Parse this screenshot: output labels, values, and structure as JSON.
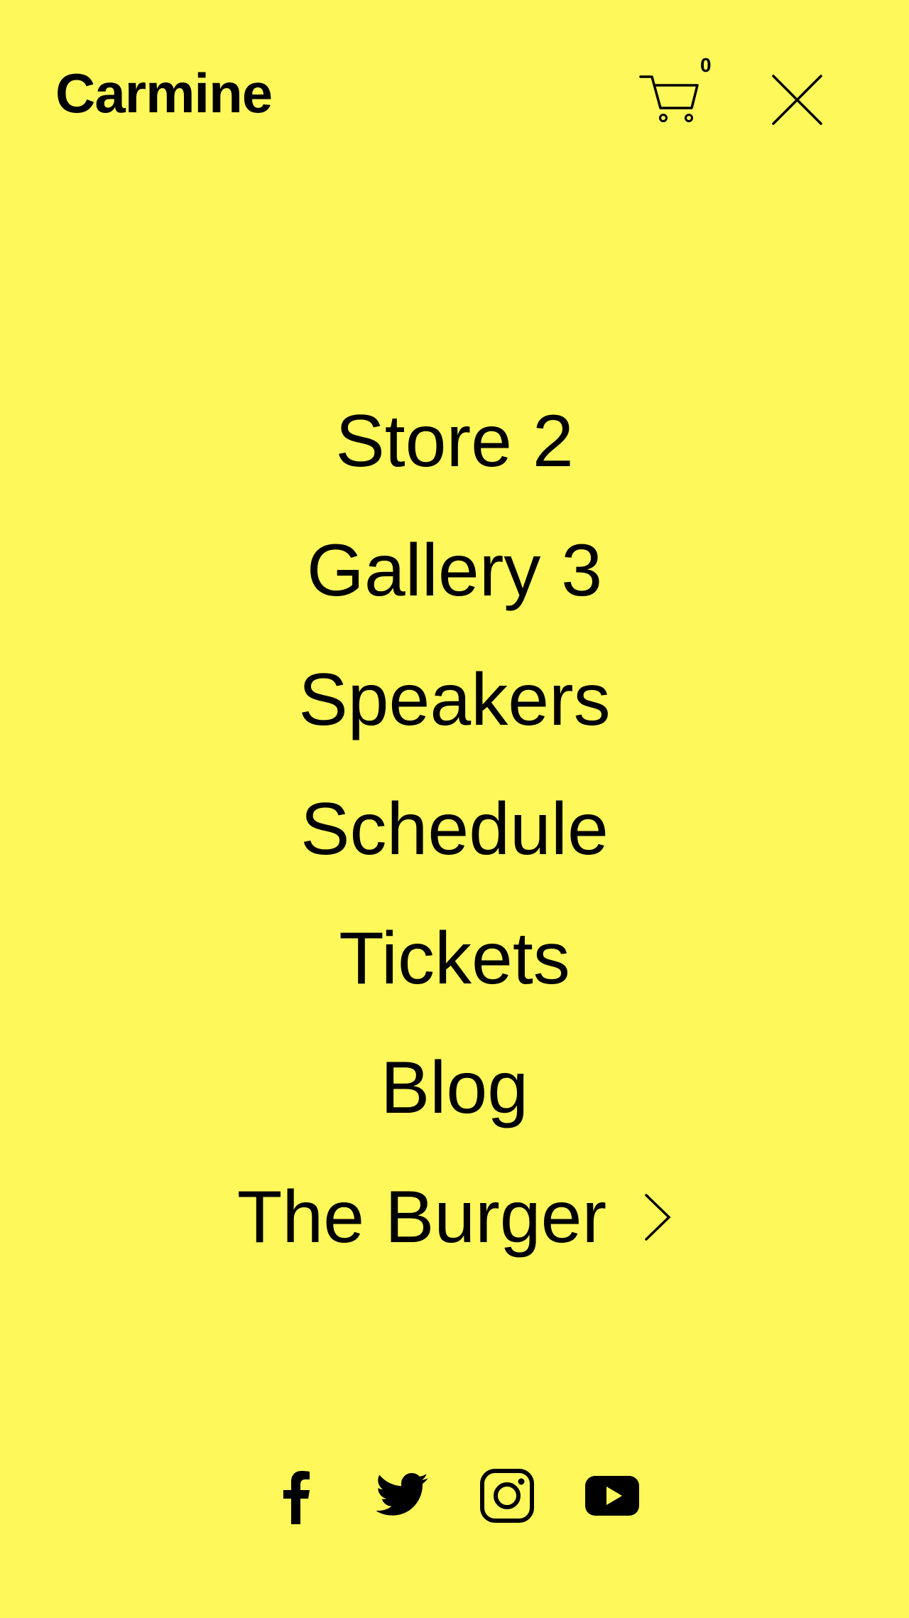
{
  "header": {
    "logo": "Carmine",
    "cart_count": "0"
  },
  "nav": {
    "items": [
      {
        "label": "Store 2"
      },
      {
        "label": "Gallery 3"
      },
      {
        "label": "Speakers"
      },
      {
        "label": "Schedule"
      },
      {
        "label": "Tickets"
      },
      {
        "label": "Blog"
      },
      {
        "label": "The Burger",
        "has_submenu": true
      }
    ]
  },
  "social": {
    "icons": [
      "facebook-icon",
      "twitter-icon",
      "instagram-icon",
      "youtube-icon"
    ]
  },
  "colors": {
    "background": "#FFF85A",
    "text": "#000000"
  }
}
